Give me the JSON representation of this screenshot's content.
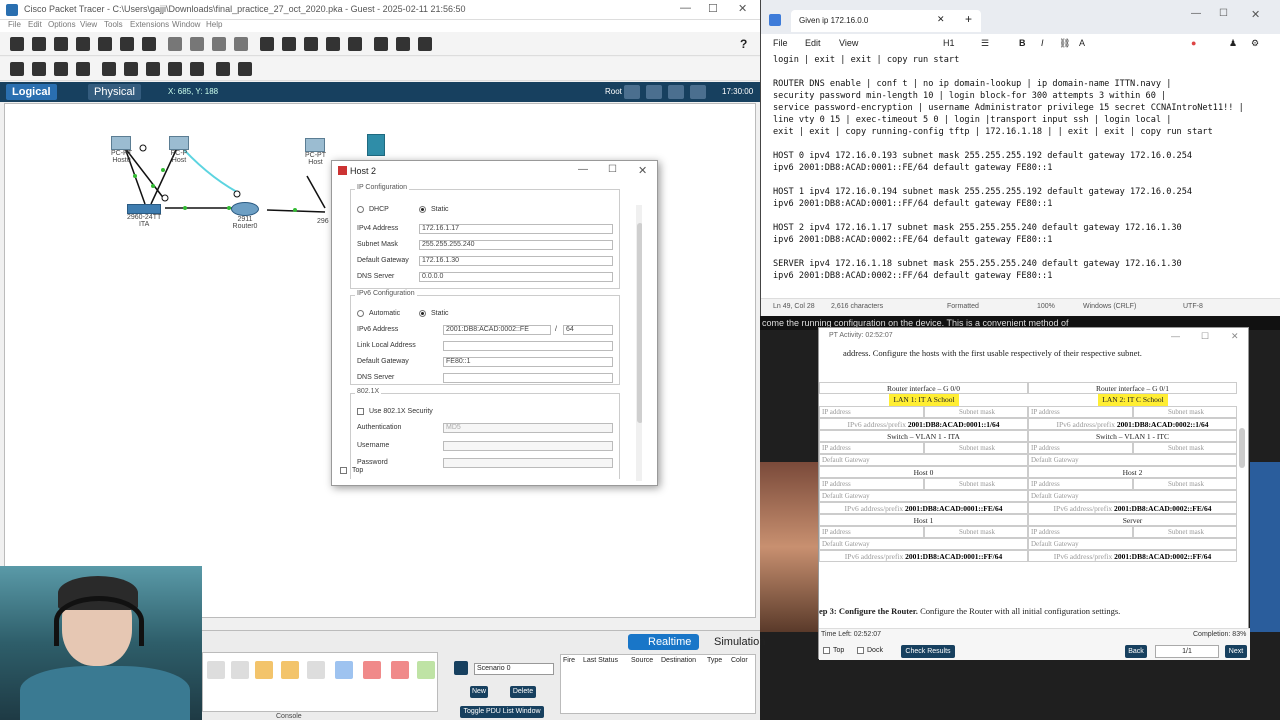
{
  "pt": {
    "title": "Cisco Packet Tracer - C:\\Users\\gajji\\Downloads\\final_practice_27_oct_2020.pka - Guest - 2025-02-11 21:56:50",
    "menu": [
      "File",
      "Edit",
      "Options",
      "View",
      "Tools",
      "Extensions",
      "Window",
      "Help"
    ],
    "tabs": {
      "logical": "Logical",
      "physical": "Physical"
    },
    "coords": "X: 685, Y: 188",
    "root": "Root",
    "clock": "17:30:00",
    "devices": [
      {
        "label": "PC-PT\nHost0"
      },
      {
        "label": "PC-P\nHost"
      },
      {
        "label": "PC-PT\nHost"
      },
      {
        "label": "2960-24TT\nITA"
      },
      {
        "label": "2911\nRouter0"
      },
      {
        "label": "296"
      }
    ],
    "bottom": {
      "realtime": "Realtime",
      "simulation": "Simulation",
      "scenario": "Scenario 0",
      "new": "New",
      "delete": "Delete",
      "toggle_pdu": "Toggle PDU List Window",
      "pdu_columns": [
        "Fire",
        "Last Status",
        "Source",
        "Destination",
        "Type",
        "Color"
      ],
      "console": "Console"
    }
  },
  "dialog": {
    "title": "Host 2",
    "ip_config_title": "IP Configuration",
    "dhcp": "DHCP",
    "static": "Static",
    "ipv4_label": "IPv4 Address",
    "ipv4": "172.16.1.17",
    "mask_label": "Subnet Mask",
    "mask": "255.255.255.240",
    "gw_label": "Default Gateway",
    "gw": "172.16.1.30",
    "dns_label": "DNS Server",
    "dns": "0.0.0.0",
    "ipv6_config_title": "IPv6 Configuration",
    "automatic": "Automatic",
    "static6": "Static",
    "ipv6_label": "IPv6 Address",
    "ipv6": "2001:DB8:ACAD:0002::FE",
    "prefix": "64",
    "link_local_label": "Link Local Address",
    "link_local": "",
    "gw6_label": "Default Gateway",
    "gw6": "FE80::1",
    "dns6_label": "DNS Server",
    "dns6": "",
    "dot1x_title": "802.1X",
    "use_dot1x": "Use 802.1X Security",
    "auth_label": "Authentication",
    "auth": "MD5",
    "username_label": "Username",
    "password_label": "Password",
    "top": "Top"
  },
  "notepad": {
    "tab_title": "Given ip 172.16.0.0",
    "menu": [
      "File",
      "Edit",
      "View"
    ],
    "heading": "H1",
    "text": "login | exit | exit | copy run start\n\nROUTER DNS enable | conf t | no ip domain-lookup | ip domain-name ITTN.navy |\nsecurity password min-length 10 | login block-for 300 attempts 3 within 60 |\nservice password-encryption | username Administrator privilege 15 secret CCNAIntroNet11!! |\nline vty 0 15 | exec-timeout 5 0 | login |transport input ssh | login local |\nexit | exit | copy running-config tftp | 172.16.1.18 | | exit | exit | copy run start\n\nHOST 0 ipv4 172.16.0.193 subnet mask 255.255.255.192 default gateway 172.16.0.254\nipv6 2001:DB8:ACAD:0001::FE/64 default gateway FE80::1\n\nHOST 1 ipv4 172.16.0.194 subnet mask 255.255.255.192 default gateway 172.16.0.254\nipv6 2001:DB8:ACAD:0001::FF/64 default gateway FE80::1\n\nHOST 2 ipv4 172.16.1.17 subnet mask 255.255.255.240 default gateway 172.16.1.30\nipv6 2001:DB8:ACAD:0002::FE/64 default gateway FE80::1\n\nSERVER ipv4 172.16.1.18 subnet mask 255.255.255.240 default gateway 172.16.1.30\nipv6 2001:DB8:ACAD:0002::FF/64 default gateway FE80::1",
    "status": {
      "pos": "Ln 49, Col 28",
      "chars": "2,616 characters",
      "formatted": "Formatted",
      "zoom": "100%",
      "eol": "Windows (CRLF)",
      "enc": "UTF-8"
    },
    "bg_text": "come the running configuration on the device. This is a convenient method of"
  },
  "activity": {
    "title": "PT Activity: 02:52:07",
    "intro": "address. Configure the hosts with the first usable respectively of their respective subnet.",
    "table": {
      "r1_left": "Router interface – G 0/0",
      "r1_right": "Router interface – G 0/1",
      "lan1": "LAN 1:  IT A School",
      "lan2": "LAN 2:  IT C School",
      "ip": "IP address",
      "mask": "Subnet mask",
      "v6_left_label": "IPv6 address/prefix",
      "v6_left": "2001:DB8:ACAD:0001::1/64",
      "v6_right_label": "IPv6 address/prefix",
      "v6_right": "2001:DB8:ACAD:0002::1/64",
      "sw_left": "Switch – VLAN 1 - ITA",
      "sw_right": "Switch – VLAN 1 - ITC",
      "gw": "Default Gateway",
      "host0": "Host 0",
      "host2": "Host 2",
      "h0_v6": "2001:DB8:ACAD:0001::FE/64",
      "h2_v6": "2001:DB8:ACAD:0002::FE/64",
      "host1": "Host 1",
      "server": "Server",
      "h1_v6": "2001:DB8:ACAD:0001::FF/64",
      "srv_v6": "2001:DB8:ACAD:0002::FF/64"
    },
    "step_bold": "ep 3: Configure the Router.",
    "step_text": " Configure the Router with all initial configuration settings.",
    "time_left": "Time Left: 02:52:07",
    "completion": "Completion: 83%",
    "top": "Top",
    "dock": "Dock",
    "check": "Check Results",
    "back": "Back",
    "page": "1/1",
    "next": "Next"
  }
}
